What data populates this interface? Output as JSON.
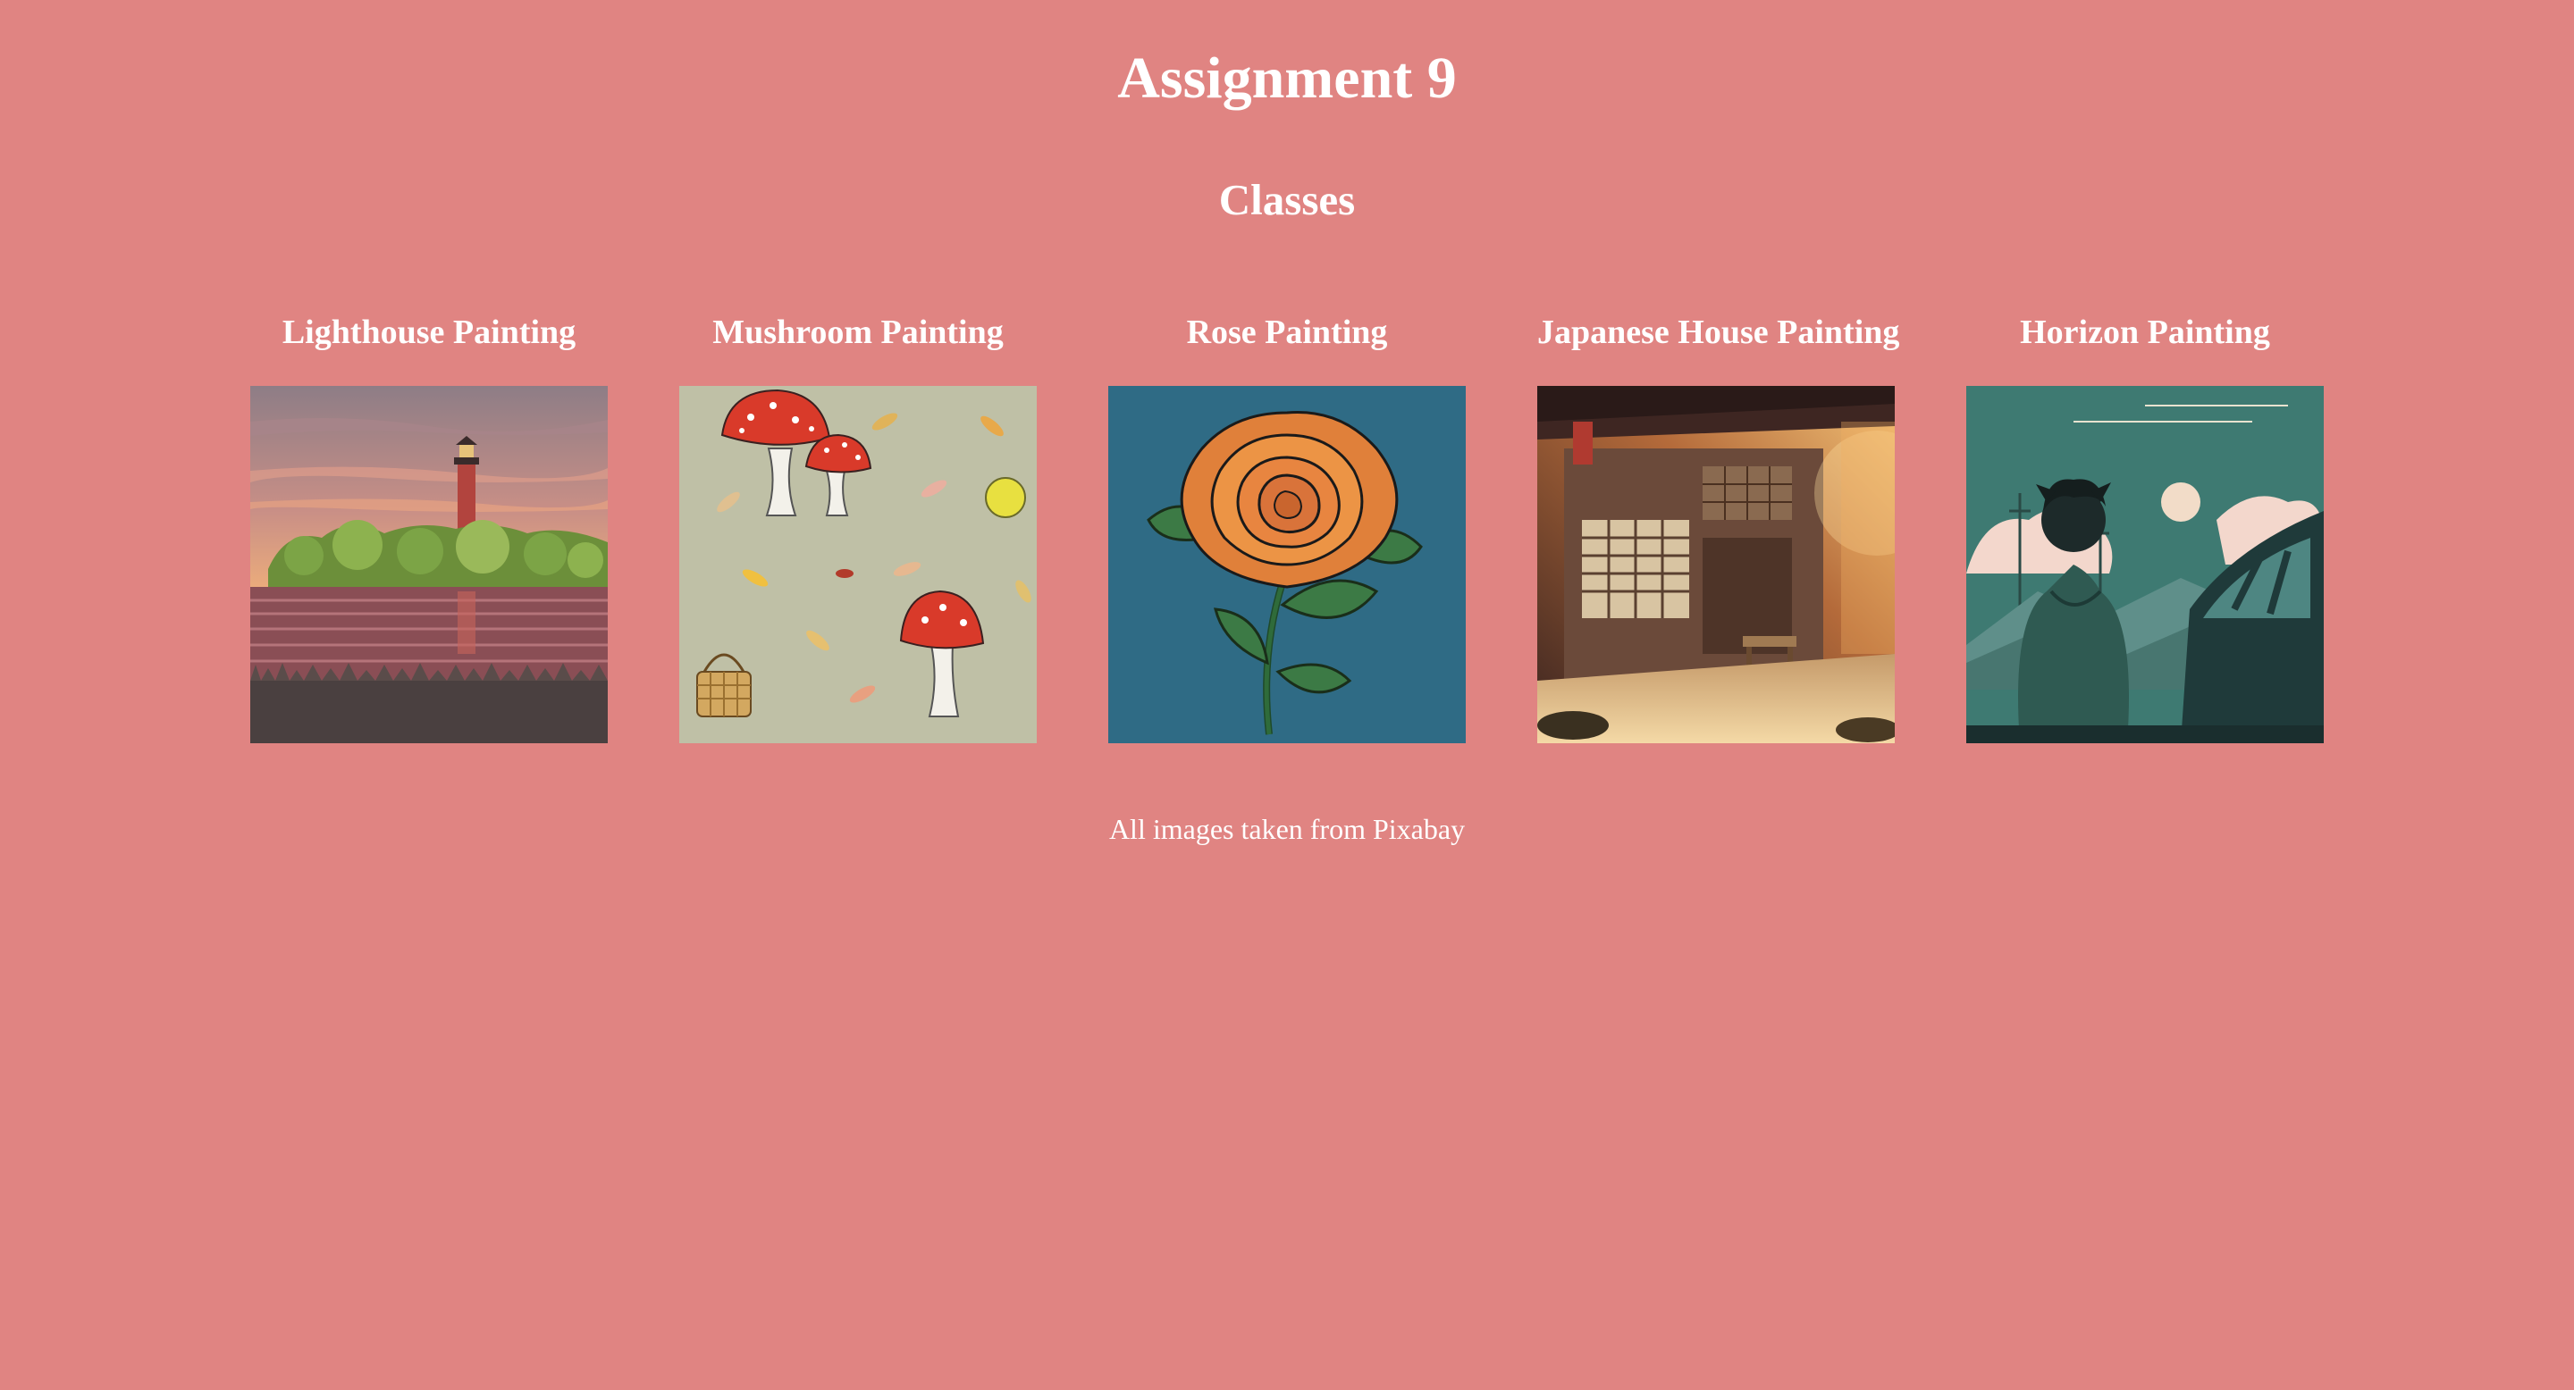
{
  "page": {
    "title": "Assignment 9",
    "section_title": "Classes",
    "background_color": "#e08482",
    "text_color": "#ffffff"
  },
  "classes": [
    {
      "title": "Lighthouse Painting",
      "image_icon": "lighthouse-painting-image"
    },
    {
      "title": "Mushroom Painting",
      "image_icon": "mushroom-painting-image"
    },
    {
      "title": "Rose Painting",
      "image_icon": "rose-painting-image"
    },
    {
      "title": "Japanese House Painting",
      "image_icon": "japanese-house-painting-image"
    },
    {
      "title": "Horizon Painting",
      "image_icon": "horizon-painting-image"
    }
  ],
  "footer": {
    "credits": "All images taken from Pixabay"
  }
}
